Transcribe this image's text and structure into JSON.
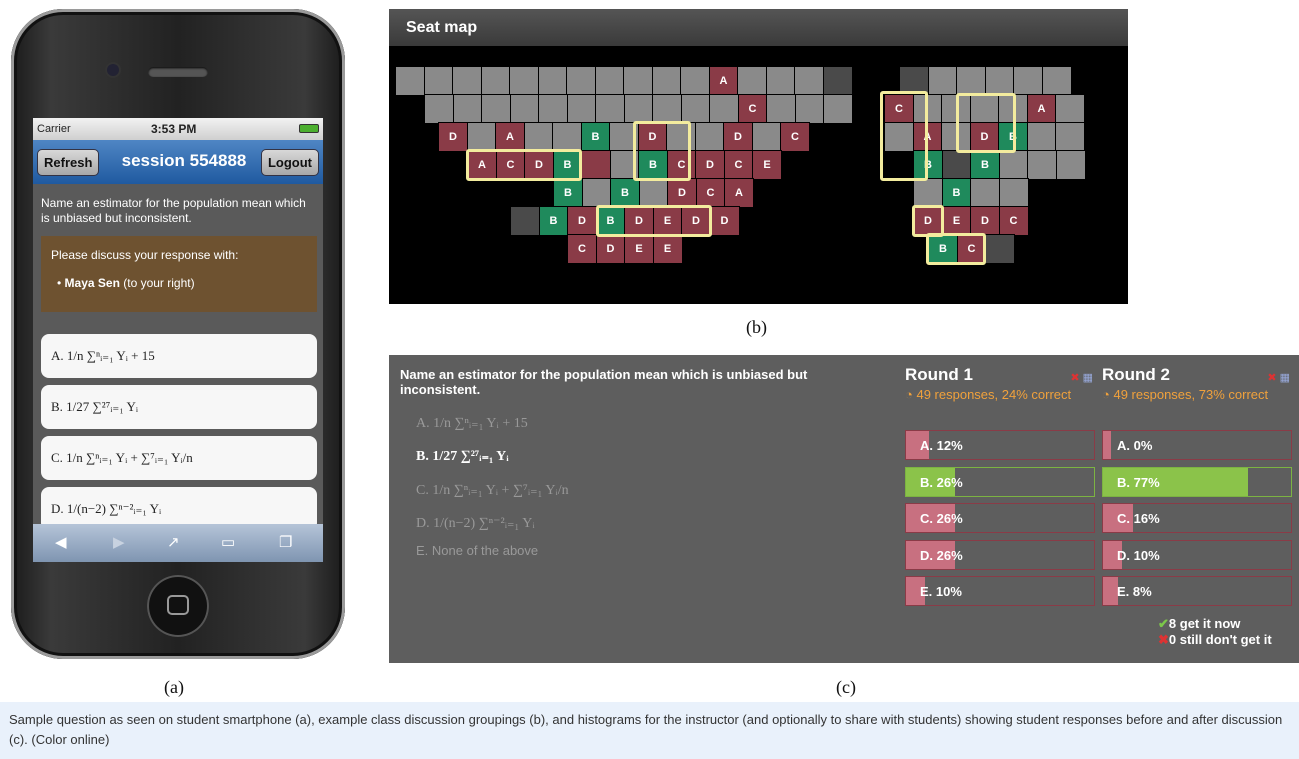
{
  "phone": {
    "carrier": "Carrier",
    "time": "3:53 PM",
    "refresh_label": "Refresh",
    "session_title": "session 554888",
    "logout_label": "Logout",
    "question": "Name an estimator for the population mean which is unbiased but inconsistent.",
    "discuss_title": "Please discuss your response with:",
    "discuss_name": "Maya Sen",
    "discuss_note": "(to your right)",
    "options": [
      "A. 1/n ∑ⁿᵢ₌₁ Yᵢ + 15",
      "B. 1/27 ∑²⁷ᵢ₌₁ Yᵢ",
      "C. 1/n ∑ⁿᵢ₌₁ Yᵢ + ∑⁷ᵢ₌₁ Yᵢ/n",
      "D. 1/(n−2) ∑ⁿ⁻²ᵢ₌₁ Yᵢ"
    ],
    "toolbar_icons": [
      "back-icon",
      "forward-icon",
      "share-icon",
      "bookmarks-icon",
      "tabs-icon"
    ]
  },
  "seatmap": {
    "title": "Seat map",
    "colors": {
      "empty": "#8a8a8a",
      "dark": "#4a4a4a",
      "wrong": "#8a3b47",
      "correct": "#1f8a5c",
      "group": "#f3ec9e"
    }
  },
  "histogram": {
    "question": "Name an estimator for the population mean which is unbiased but inconsistent.",
    "options": [
      "A. 1/n ∑ⁿᵢ₌₁ Yᵢ + 15",
      "B. 1/27 ∑²⁷ᵢ₌₁ Yᵢ",
      "C. 1/n ∑ⁿᵢ₌₁ Yᵢ + ∑⁷ᵢ₌₁ Yᵢ/n",
      "D. 1/(n−2) ∑ⁿ⁻²ᵢ₌₁ Yᵢ",
      "E. None of the above"
    ],
    "rounds": [
      {
        "title": "Round 1",
        "stat": "49 responses, 24% correct",
        "bars": [
          {
            "label": "A. 12%",
            "value": 12
          },
          {
            "label": "B. 26%",
            "value": 26
          },
          {
            "label": "C. 26%",
            "value": 26
          },
          {
            "label": "D. 26%",
            "value": 26
          },
          {
            "label": "E. 10%",
            "value": 10
          }
        ]
      },
      {
        "title": "Round 2",
        "stat": "49 responses, 73% correct",
        "bars": [
          {
            "label": "A. 0%",
            "value": 0
          },
          {
            "label": "B. 77%",
            "value": 77
          },
          {
            "label": "C. 16%",
            "value": 16
          },
          {
            "label": "D. 10%",
            "value": 10
          },
          {
            "label": "E. 8%",
            "value": 8
          }
        ]
      }
    ],
    "get_it_now": "8 get it now",
    "still_dont": "0 still don't get it"
  },
  "labels": {
    "a": "(a)",
    "b": "(b)",
    "c": "(c)"
  },
  "caption": "Sample question as seen on student smartphone (a), example class discussion groupings (b), and histograms for the instructor (and optionally to share with students) showing student responses before and after discussion (c). (Color online)"
}
